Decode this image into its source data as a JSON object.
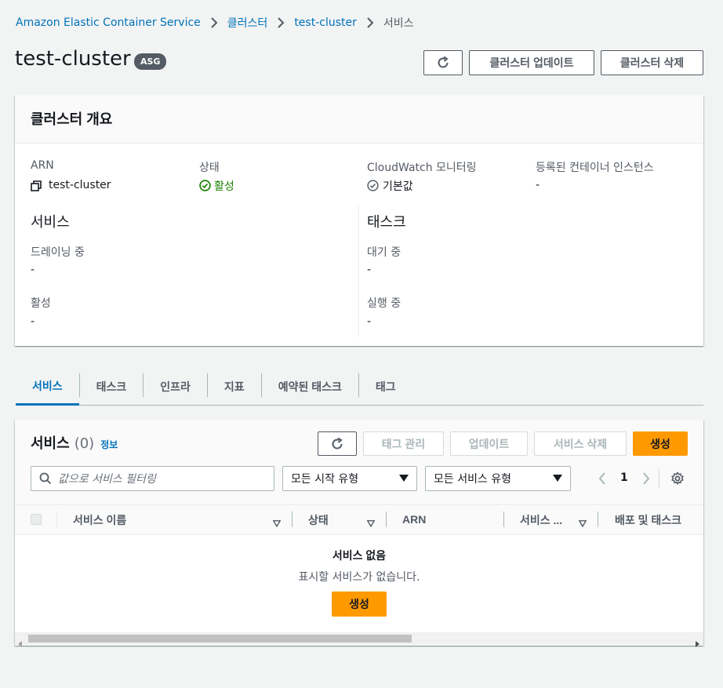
{
  "breadcrumb": {
    "items": [
      "Amazon Elastic Container Service",
      "클러스터",
      "test-cluster"
    ],
    "current": "서비스"
  },
  "header": {
    "title": "test-cluster",
    "badge": "ASG",
    "update_button": "클러스터 업데이트",
    "delete_button": "클러스터 삭제"
  },
  "overview": {
    "title": "클러스터 개요",
    "arn_label": "ARN",
    "arn_value": "test-cluster",
    "status_label": "상태",
    "status_value": "활성",
    "cloudwatch_label": "CloudWatch 모니터링",
    "cloudwatch_value": "기본값",
    "instances_label": "등록된 컨테이너 인스턴스",
    "instances_value": "-",
    "services_heading": "서비스",
    "draining_label": "드레이닝 중",
    "draining_value": "-",
    "active_label": "활성",
    "active_value": "-",
    "tasks_heading": "태스크",
    "pending_label": "대기 중",
    "pending_value": "-",
    "running_label": "실행 중",
    "running_value": "-"
  },
  "tabs": [
    "서비스",
    "태스크",
    "인프라",
    "지표",
    "예약된 태스크",
    "태그"
  ],
  "services_panel": {
    "title": "서비스",
    "count": "(0)",
    "info_link": "정보",
    "manage_tags_button": "태그 관리",
    "update_button": "업데이트",
    "delete_button": "서비스 삭제",
    "create_button": "생성",
    "filter_placeholder": "값으로 서비스 필터링",
    "launch_type_select": "모든 시작 유형",
    "service_type_select": "모든 서비스 유형",
    "page_number": "1",
    "columns": [
      "서비스 이름",
      "상태",
      "ARN",
      "서비스 ...",
      "배포 및 태스크"
    ],
    "empty_title": "서비스 없음",
    "empty_desc": "표시할 서비스가 없습니다.",
    "empty_create_button": "생성"
  },
  "colors": {
    "link": "#0073bb",
    "success": "#1d8102",
    "primary": "#ff9900"
  }
}
